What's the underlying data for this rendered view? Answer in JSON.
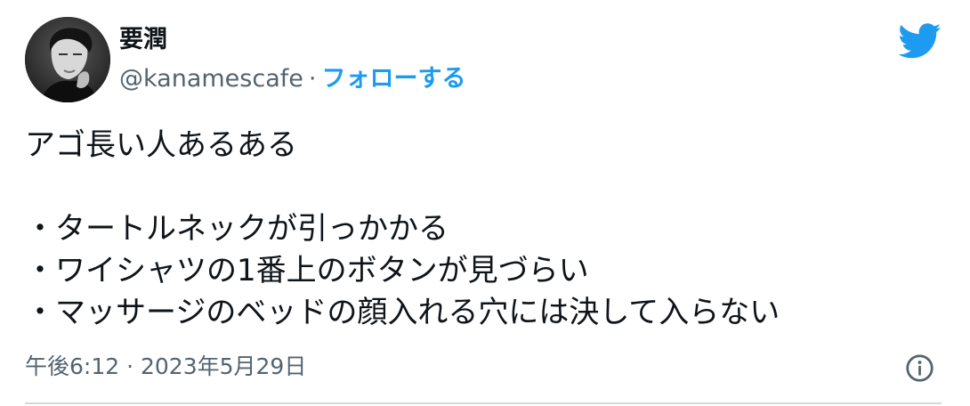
{
  "author": {
    "display_name": "要潤",
    "handle": "@kanamescafe",
    "separator": "·",
    "follow_label": "フォローする"
  },
  "brand": {
    "icon": "twitter-bird-icon",
    "color": "#1d9bf0"
  },
  "tweet": {
    "lines": [
      "アゴ長い人あるある",
      "",
      "・タートルネックが引っかかる",
      "・ワイシャツの1番上のボタンが見づらい",
      "・マッサージのベッドの顔入れる穴には決して入らない"
    ]
  },
  "meta": {
    "time": "午後6:12",
    "separator": "·",
    "date": "2023年5月29日",
    "info_icon": "info-icon"
  },
  "colors": {
    "text": "#0f1419",
    "secondary": "#536471",
    "accent": "#1d9bf0",
    "divider": "#cfd9de"
  }
}
